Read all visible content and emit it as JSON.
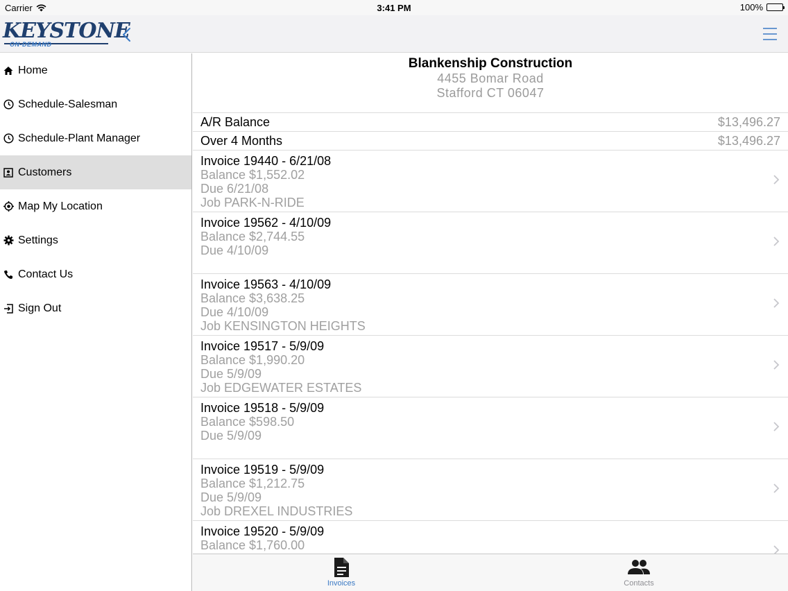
{
  "status_bar": {
    "carrier": "Carrier",
    "time": "3:41 PM",
    "battery": "100%"
  },
  "nav": {
    "logo_text": "KEYSTONE",
    "logo_sub": "ON-DEMAND",
    "accent_color": "#3a79c4"
  },
  "sidebar": {
    "items": [
      {
        "label": "Home",
        "icon": "home-icon"
      },
      {
        "label": "Schedule-Salesman",
        "icon": "clock-icon"
      },
      {
        "label": "Schedule-Plant Manager",
        "icon": "clock-icon"
      },
      {
        "label": "Customers",
        "icon": "contact-card-icon",
        "active": true
      },
      {
        "label": "Map My Location",
        "icon": "location-target-icon"
      },
      {
        "label": "Settings",
        "icon": "gear-icon"
      },
      {
        "label": "Contact Us",
        "icon": "phone-icon"
      },
      {
        "label": "Sign Out",
        "icon": "sign-out-icon"
      }
    ]
  },
  "customer": {
    "name": "Blankenship Construction",
    "address1": "4455 Bomar Road",
    "address2": "Stafford CT 06047"
  },
  "summary": [
    {
      "label": "A/R Balance",
      "value": "$13,496.27"
    },
    {
      "label": "Over 4 Months",
      "value": "$13,496.27"
    }
  ],
  "invoices": [
    {
      "title": "Invoice 19440 - 6/21/08",
      "balance": "Balance $1,552.02",
      "due": "Due 6/21/08",
      "job": "Job PARK-N-RIDE"
    },
    {
      "title": "Invoice 19562 - 4/10/09",
      "balance": "Balance $2,744.55",
      "due": "Due 4/10/09",
      "job": ""
    },
    {
      "title": "Invoice 19563 - 4/10/09",
      "balance": "Balance $3,638.25",
      "due": "Due 4/10/09",
      "job": "Job KENSINGTON HEIGHTS"
    },
    {
      "title": "Invoice 19517 - 5/9/09",
      "balance": "Balance $1,990.20",
      "due": "Due 5/9/09",
      "job": "Job EDGEWATER ESTATES"
    },
    {
      "title": "Invoice 19518 - 5/9/09",
      "balance": "Balance $598.50",
      "due": "Due 5/9/09",
      "job": ""
    },
    {
      "title": "Invoice 19519 - 5/9/09",
      "balance": "Balance $1,212.75",
      "due": "Due 5/9/09",
      "job": "Job DREXEL INDUSTRIES"
    },
    {
      "title": "Invoice 19520 - 5/9/09",
      "balance": "Balance $1,760.00",
      "due": "",
      "job": ""
    }
  ],
  "tabs": [
    {
      "label": "Invoices",
      "icon": "document-icon",
      "active": true
    },
    {
      "label": "Contacts",
      "icon": "people-icon",
      "active": false
    }
  ]
}
